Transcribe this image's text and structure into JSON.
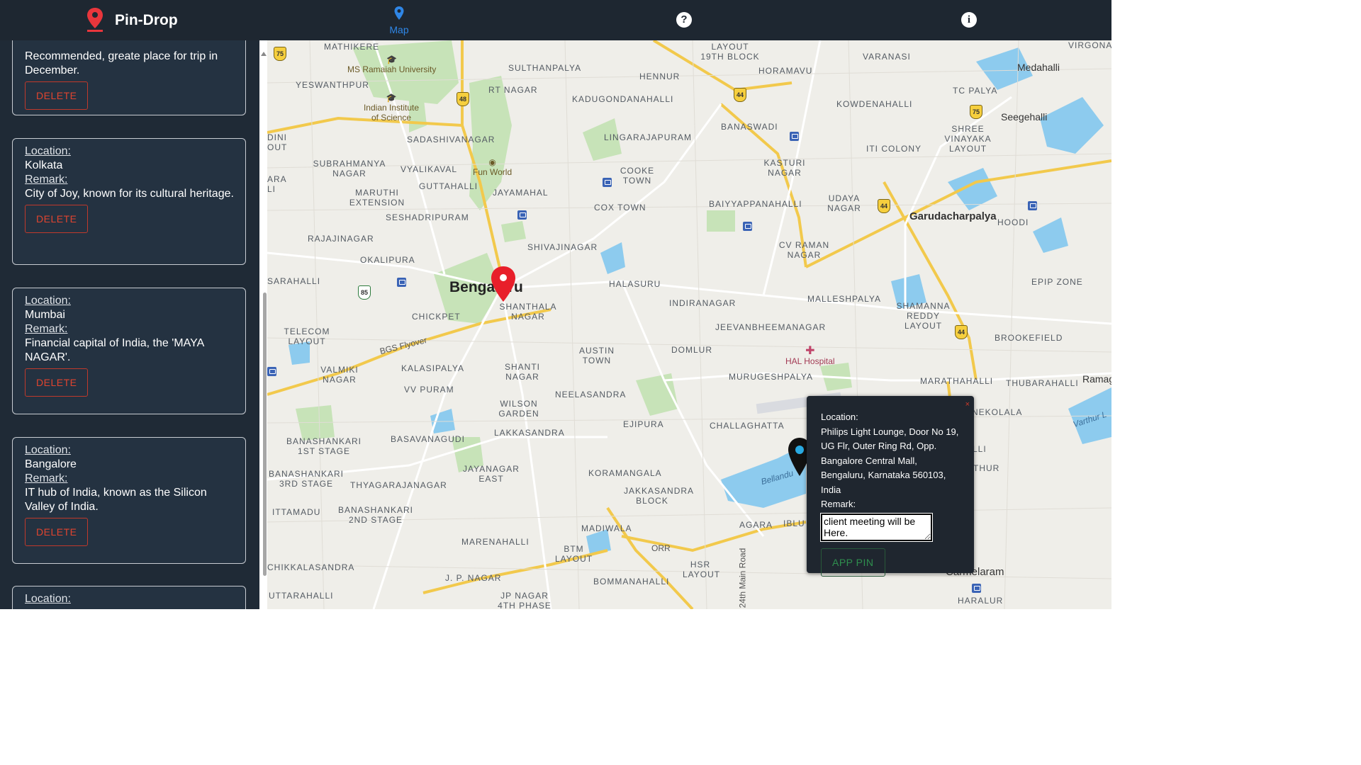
{
  "header": {
    "brand": "Pin-Drop",
    "brand_icon": "location-pin-icon",
    "nav": {
      "map_label": "Map",
      "help_icon": "question-icon",
      "info_icon": "info-icon"
    },
    "colors": {
      "bar": "#1e2731",
      "accent": "#2f86e6",
      "brand_pin": "#e8363c"
    }
  },
  "sidebar": {
    "delete_label": "DELETE",
    "location_key": "Location:",
    "remark_key": "Remark:",
    "cards": [
      {
        "remark": "Recommended, greate place for trip in December."
      },
      {
        "location": "Kolkata",
        "remark": "City of Joy, known for its cultural heritage."
      },
      {
        "location": "Mumbai",
        "remark": "Financial capital of India, the 'MAYA NAGAR'."
      },
      {
        "location": "Bangalore",
        "remark": "IT hub of India, known as the Silicon Valley of India."
      },
      {
        "location_key_partial": "Location:"
      }
    ]
  },
  "map": {
    "city_label": "Bengaluru",
    "towns": {
      "garudacharpalya": "Garudacharpalya",
      "medahalli": "Medahalli",
      "seegehalli": "Seegehalli",
      "carmelaram": "Carmelaram",
      "ramag": "Ramag"
    },
    "places": [
      "MATHIKERE",
      "SULTHANPALYA",
      "LAYOUT 19TH BLOCK",
      "VARANASI",
      "VIRGONAG",
      "HENNUR",
      "HORAMAVU",
      "YESWANTHPUR",
      "RT NAGAR",
      "KADUGONDANAHALLI",
      "TC PALYA",
      "KOWDENAHALLI",
      "DINI OUT",
      "BANASWADI",
      "SHREE VINAYAKA LAYOUT",
      "LINGARAJAPURAM",
      "ITI COLONY",
      "SADASHIVANAGAR",
      "SUBRAHMANYA NAGAR",
      "VYALIKAVAL",
      "KASTURI NAGAR",
      "ARA LI",
      "GUTTAHALLI",
      "COOKE TOWN",
      "MARUTHI EXTENSION",
      "JAYAMAHAL",
      "UDAYA NAGAR",
      "BAIYYAPPANAHALLI",
      "COX TOWN",
      "SESHADRIPURAM",
      "HOODI",
      "RAJAJINAGAR",
      "CV RAMAN NAGAR",
      "SHIVAJINAGAR",
      "OKALIPURA",
      "EPIP ZONE",
      "SARAHALLI",
      "HALASURU",
      "MALLESHPALYA",
      "SHANTHALA NAGAR",
      "INDIRANAGAR",
      "SHAMANNA REDDY LAYOUT",
      "CHICKPET",
      "JEEVANBHEEMANAGAR",
      "TELECOM LAYOUT",
      "BROOKEFIELD",
      "DOMLUR",
      "AUSTIN TOWN",
      "VALMIKI NAGAR",
      "KALASIPALYA",
      "SHANTI NAGAR",
      "MURUGESHPALYA",
      "MARATHAHALLI",
      "THUBARAHALLI",
      "VV PURAM",
      "NEELASANDRA",
      "NEKOLALA",
      "WILSON GARDEN",
      "EJIPURA",
      "CHALLAGHATTA",
      "BANASHANKARI 1ST STAGE",
      "BASAVANAGUDI",
      "LAKKASANDRA",
      "LLI",
      "BANASHANKARI 3RD STAGE",
      "JAYANAGAR EAST",
      "KORAMANGALA",
      "THUR",
      "THYAGARAJANAGAR",
      "JAKKASANDRA BLOCK",
      "ITTAMADU",
      "BANASHANKARI 2ND STAGE",
      "AGARA",
      "IBLU",
      "MADIWALA",
      "MARENAHALLI",
      "BTM LAYOUT",
      "HSR LAYOUT",
      "CHIKKALASANDRA",
      "J. P. NAGAR",
      "BOMMANAHALLI",
      "UTTARAHALLI",
      "JP NAGAR 4TH PHASE",
      "HARALUR"
    ],
    "pois": {
      "ms_ramaiah": "MS Ramaiah University",
      "iisc": "Indian Institute of Science",
      "fun_world": "Fun World",
      "hal": "HAL Hospital",
      "bgs": "BGS Flyover",
      "bellandur": "Bellandu",
      "varthur": "Varthur L",
      "main_road": "24th Main Road",
      "orr": "ORR"
    },
    "shields": [
      "75",
      "48",
      "44",
      "75",
      "44",
      "44",
      "85"
    ]
  },
  "popup": {
    "close": "×",
    "location_label": "Location:",
    "address": "Philips Light Lounge, Door No 19, UG Flr, Outer Ring Rd, Opp. Bangalore Central Mall, Bengaluru, Karnataka 560103, India",
    "remark_label": "Remark:",
    "remark_value": "client meeting will be Here.",
    "add_button": "APP PIN"
  }
}
